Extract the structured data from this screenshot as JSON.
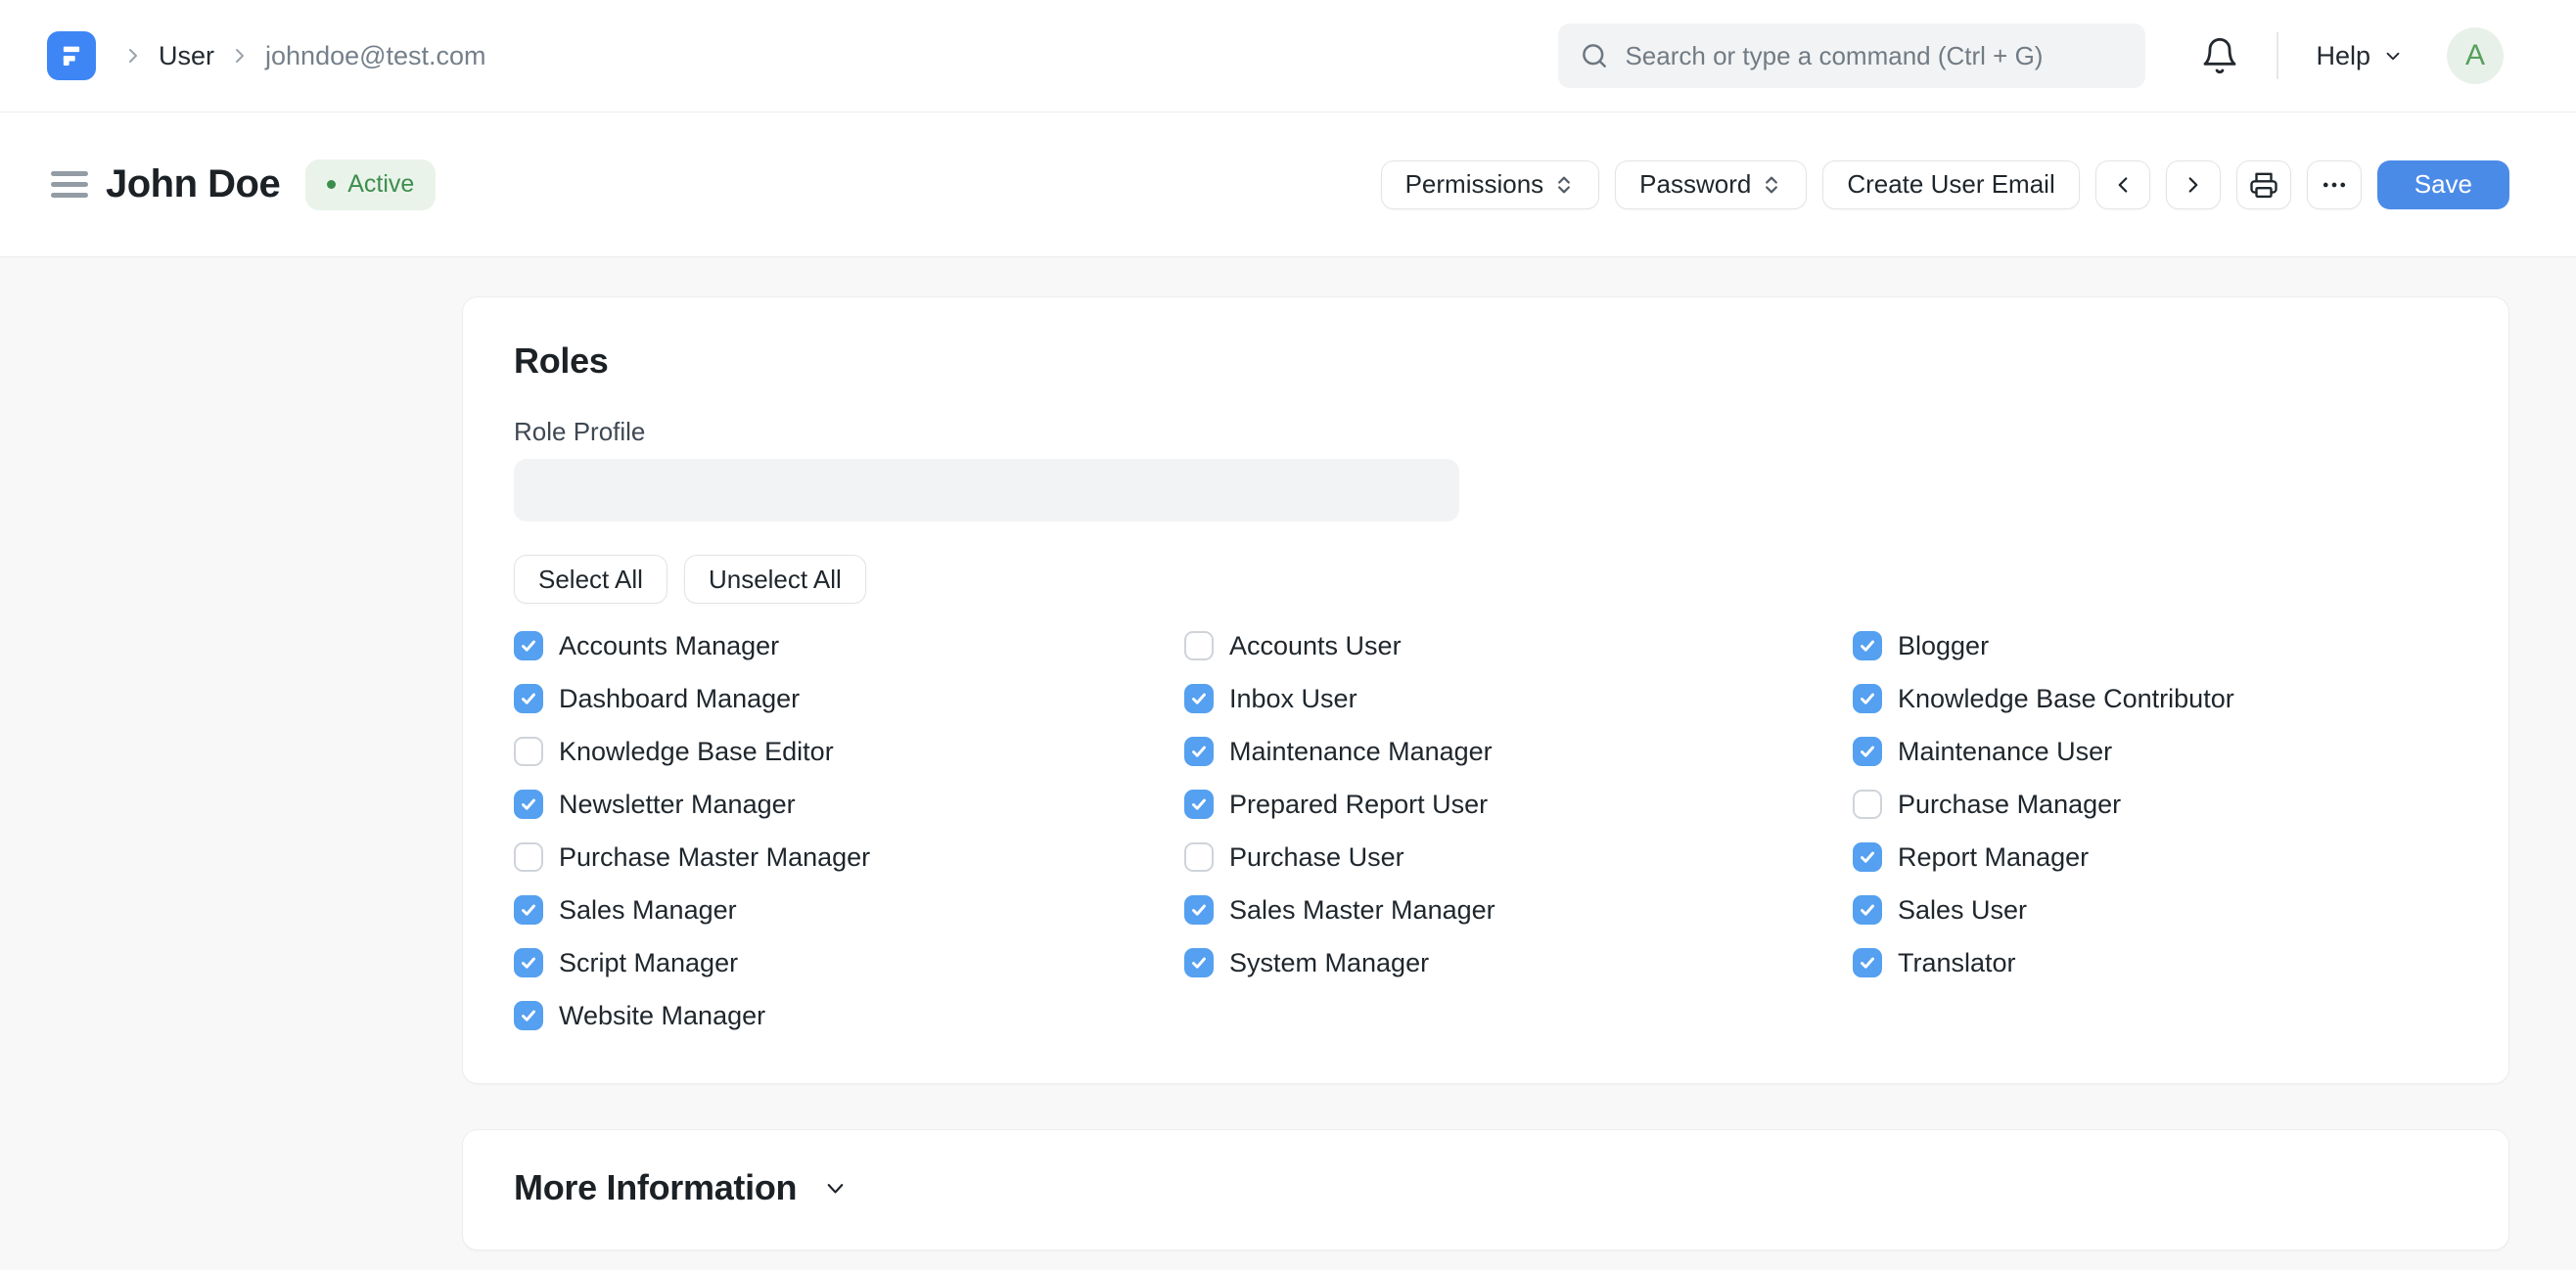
{
  "navbar": {
    "logo_letter": "F",
    "breadcrumb": {
      "level1": "User",
      "level2": "johndoe@test.com"
    },
    "search_placeholder": "Search or type a command (Ctrl + G)",
    "help_label": "Help",
    "avatar_letter": "A"
  },
  "header": {
    "title": "John Doe",
    "status_badge": "Active",
    "permissions_label": "Permissions",
    "password_label": "Password",
    "create_user_email_label": "Create User Email",
    "save_label": "Save"
  },
  "roles_card": {
    "heading": "Roles",
    "role_profile_label": "Role Profile",
    "role_profile_value": "",
    "select_all_label": "Select All",
    "unselect_all_label": "Unselect All",
    "columns": [
      [
        {
          "label": "Accounts Manager",
          "checked": true
        },
        {
          "label": "Dashboard Manager",
          "checked": true
        },
        {
          "label": "Knowledge Base Editor",
          "checked": false
        },
        {
          "label": "Newsletter Manager",
          "checked": true
        },
        {
          "label": "Purchase Master Manager",
          "checked": false
        },
        {
          "label": "Sales Manager",
          "checked": true
        },
        {
          "label": "Script Manager",
          "checked": true
        },
        {
          "label": "Website Manager",
          "checked": true
        }
      ],
      [
        {
          "label": "Accounts User",
          "checked": false
        },
        {
          "label": "Inbox User",
          "checked": true
        },
        {
          "label": "Maintenance Manager",
          "checked": true
        },
        {
          "label": "Prepared Report User",
          "checked": true
        },
        {
          "label": "Purchase User",
          "checked": false
        },
        {
          "label": "Sales Master Manager",
          "checked": true
        },
        {
          "label": "System Manager",
          "checked": true
        }
      ],
      [
        {
          "label": "Blogger",
          "checked": true
        },
        {
          "label": "Knowledge Base Contributor",
          "checked": true
        },
        {
          "label": "Maintenance User",
          "checked": true
        },
        {
          "label": "Purchase Manager",
          "checked": false
        },
        {
          "label": "Report Manager",
          "checked": true
        },
        {
          "label": "Sales User",
          "checked": true
        },
        {
          "label": "Translator",
          "checked": true
        }
      ]
    ]
  },
  "more_info_card": {
    "heading": "More Information"
  },
  "icons": {
    "logo": "frappe-f-mark",
    "search": "magnifier",
    "notifications": "bell-outline",
    "help_caret": "chevron-down",
    "breadcrumb_sep": "chevron-right",
    "select_toggle": "chevron-up-down",
    "prev": "chevron-left",
    "next": "chevron-right",
    "print": "printer",
    "menu": "ellipsis",
    "checkbox_check": "checkmark",
    "more_info_caret": "chevron-down"
  },
  "colors": {
    "accent_blue": "#4b8be8",
    "checkbox_blue": "#55a0f0",
    "logo_blue": "#3e86f5",
    "badge_green_text": "#3d8e4e",
    "badge_green_bg": "#eaf3ea",
    "avatar_green": "#57a05c",
    "avatar_bg": "#e8f1e9",
    "page_bg": "#f8f8f8",
    "card_bg": "#ffffff"
  }
}
